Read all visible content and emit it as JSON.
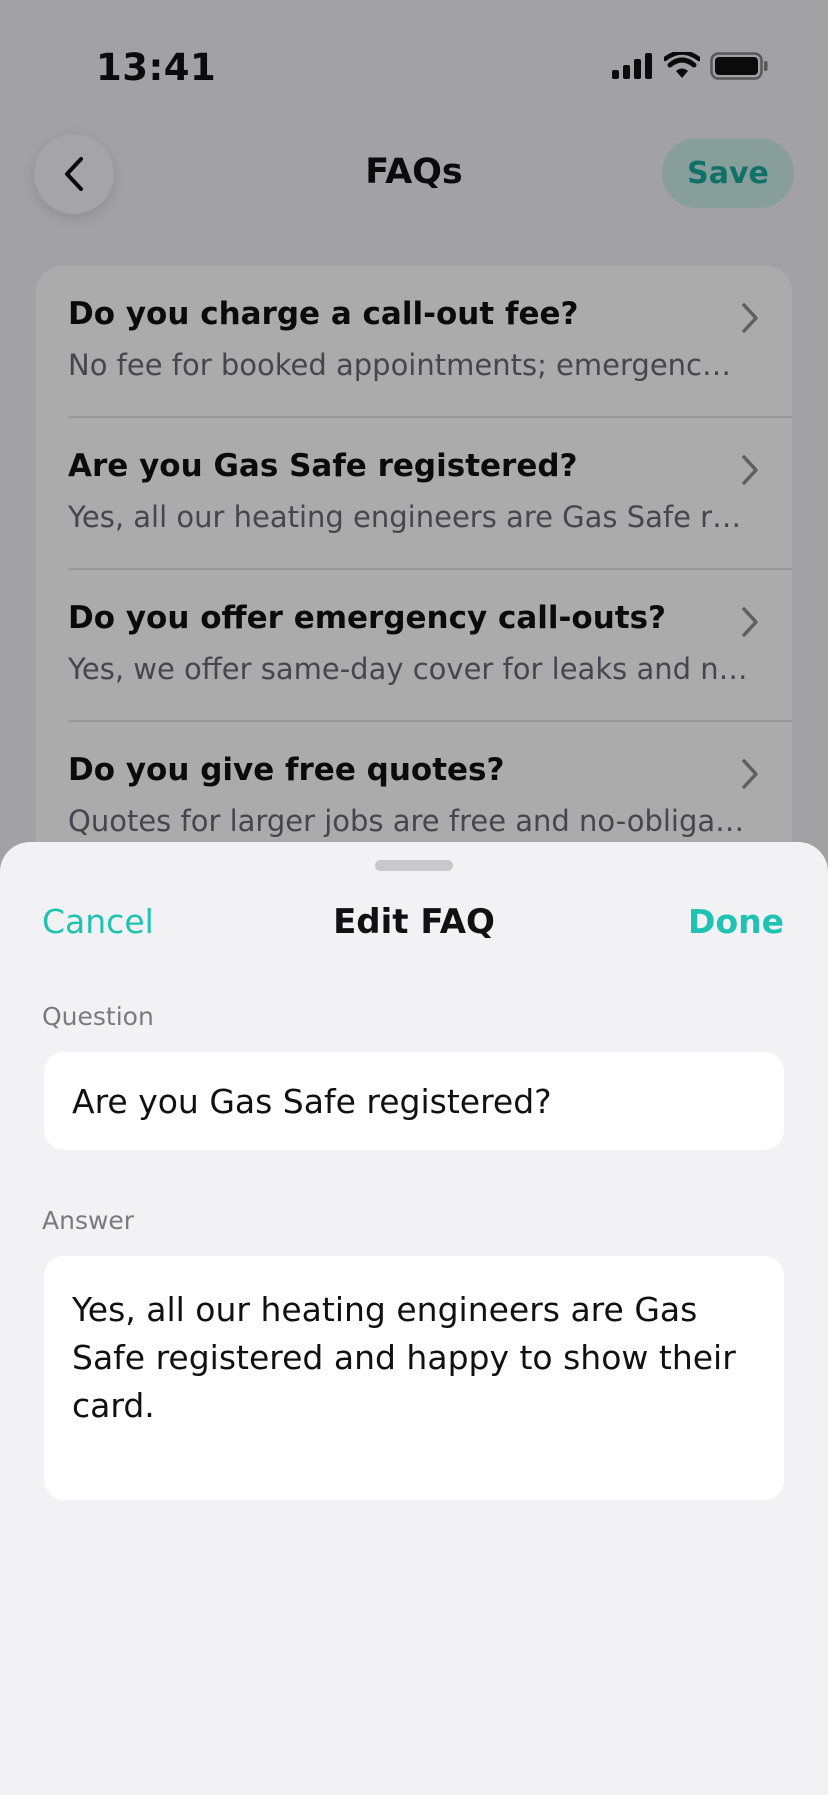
{
  "status_bar": {
    "time": "13:41",
    "icons": [
      "cellular-signal-icon",
      "wifi-icon",
      "battery-icon"
    ]
  },
  "header": {
    "back_icon": "chevron-left-icon",
    "title": "FAQs",
    "save_label": "Save"
  },
  "faqs": [
    {
      "question": "Do you charge a call-out fee?",
      "answer": "No fee for booked appointments; emergenc…"
    },
    {
      "question": "Are you Gas Safe registered?",
      "answer": "Yes, all our heating engineers are Gas Safe r…"
    },
    {
      "question": "Do you offer emergency call-outs?",
      "answer": "Yes, we offer same-day cover for leaks and n…"
    },
    {
      "question": "Do you give free quotes?",
      "answer": "Quotes for larger jobs are free and no-obliga…"
    }
  ],
  "sheet": {
    "cancel_label": "Cancel",
    "title": "Edit FAQ",
    "done_label": "Done",
    "question_label": "Question",
    "question_value": "Are you Gas Safe registered?",
    "answer_label": "Answer",
    "answer_value": "Yes, all our heating engineers are Gas Safe registered and happy to show their card."
  },
  "colors": {
    "accent": "#20c2b2",
    "save_button_bg": "#c9ece8",
    "background": "#f2f2f5"
  }
}
